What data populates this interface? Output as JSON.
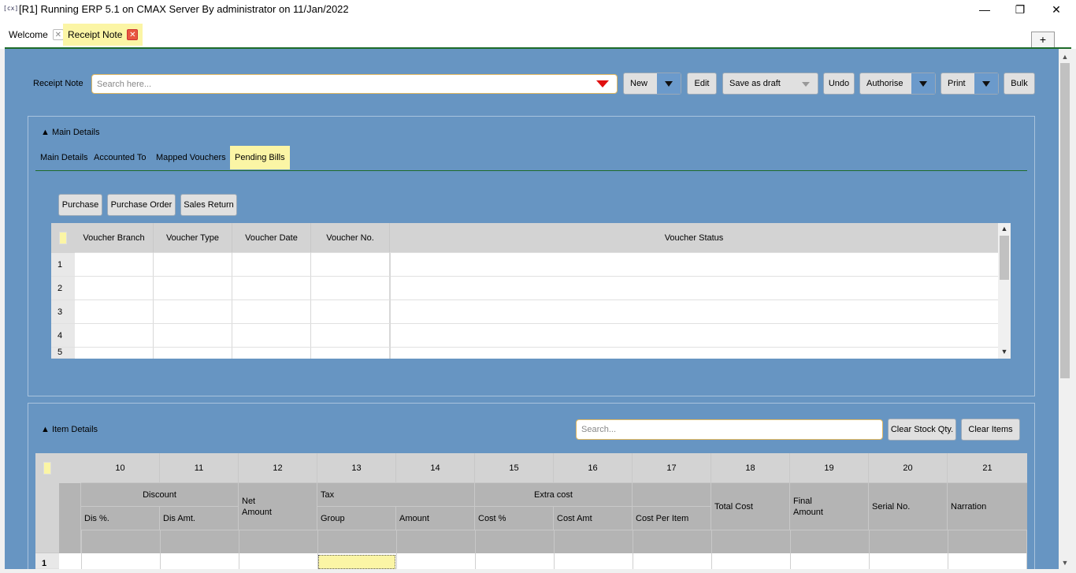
{
  "window": {
    "app_icon": "[cx]",
    "title": "[R1] Running ERP 5.1 on CMAX Server By administrator on 11/Jan/2022",
    "minimize": "—",
    "maximize": "❐",
    "close": "✕"
  },
  "tabs": [
    {
      "label": "Welcome",
      "close": "✕"
    },
    {
      "label": "Receipt Note",
      "close": "✕"
    }
  ],
  "add_tab": "+",
  "toolbar": {
    "form_label": "Receipt Note",
    "search_placeholder": "Search here...",
    "new": "New",
    "edit": "Edit",
    "save_draft": "Save as draft",
    "undo": "Undo",
    "authorise": "Authorise",
    "print": "Print",
    "bulk": "Bulk"
  },
  "main_details": {
    "header": "▲ Main Details",
    "tabs": [
      "Main Details",
      "Accounted To",
      "Mapped Vouchers",
      "Pending Bills"
    ],
    "active_tab": "Pending Bills",
    "filter_buttons": [
      "Purchase",
      "Purchase Order",
      "Sales Return"
    ],
    "columns": [
      "Voucher Branch",
      "Voucher Type",
      "Voucher Date",
      "Voucher No.",
      "Voucher Status"
    ],
    "rows": [
      "1",
      "2",
      "3",
      "4",
      "5"
    ]
  },
  "item_details": {
    "header": "▲ Item Details",
    "search_placeholder": "Search...",
    "clear_stock": "Clear Stock Qty.",
    "clear_items": "Clear Items",
    "col_numbers": [
      "10",
      "11",
      "12",
      "13",
      "14",
      "15",
      "16",
      "17",
      "18",
      "19",
      "20",
      "21"
    ],
    "groups": {
      "discount": "Discount",
      "net_amount": "Net\nAmount",
      "tax": "Tax",
      "extra_cost": "Extra cost",
      "total_cost": "Total Cost",
      "final_amount": "Final\nAmount",
      "serial_no": "Serial No.",
      "narration": "Narration"
    },
    "sub": {
      "dis_pct": "Dis %.",
      "dis_amt": "Dis Amt.",
      "group": "Group",
      "amount": "Amount",
      "cost_pct": "Cost %",
      "cost_amt": "Cost Amt",
      "cost_per_item": "Cost Per Item"
    },
    "first_row": "1"
  }
}
